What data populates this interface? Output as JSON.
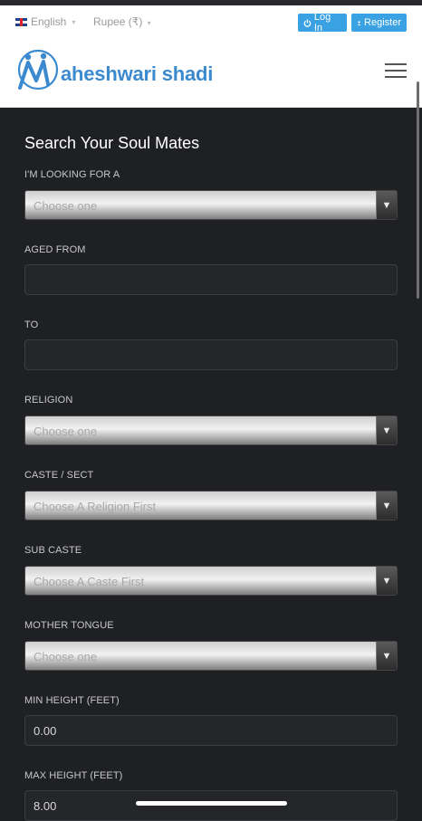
{
  "topbar": {
    "language": "English",
    "currency": "Rupee (₹)",
    "login_label": "Log In",
    "register_label": "Register"
  },
  "brand": {
    "logo_text": "aheshwari shadi",
    "color": "#3b8ad0"
  },
  "icons": [
    "uk-flag-icon",
    "power-icon",
    "user-icon",
    "hamburger-menu-icon",
    "dropdown-arrow-icon"
  ],
  "form": {
    "title": "Search Your Soul Mates",
    "looking_for": {
      "label": "I'M LOOKING FOR A",
      "placeholder": "Choose one"
    },
    "aged_from": {
      "label": "AGED FROM",
      "value": ""
    },
    "to": {
      "label": "TO",
      "value": ""
    },
    "religion": {
      "label": "RELIGION",
      "placeholder": "Choose one"
    },
    "caste": {
      "label": "CASTE / SECT",
      "placeholder": "Choose A Religion First"
    },
    "sub_caste": {
      "label": "SUB CASTE",
      "placeholder": "Choose A Caste First"
    },
    "mother_tongue": {
      "label": "MOTHER TONGUE",
      "placeholder": "Choose one"
    },
    "min_height": {
      "label": "MIN HEIGHT (FEET)",
      "value": "0.00"
    },
    "max_height": {
      "label": "MAX HEIGHT (FEET)",
      "value": "8.00"
    }
  },
  "colors": {
    "accent": "#3aa2e3",
    "page_background": "#1f2024"
  }
}
